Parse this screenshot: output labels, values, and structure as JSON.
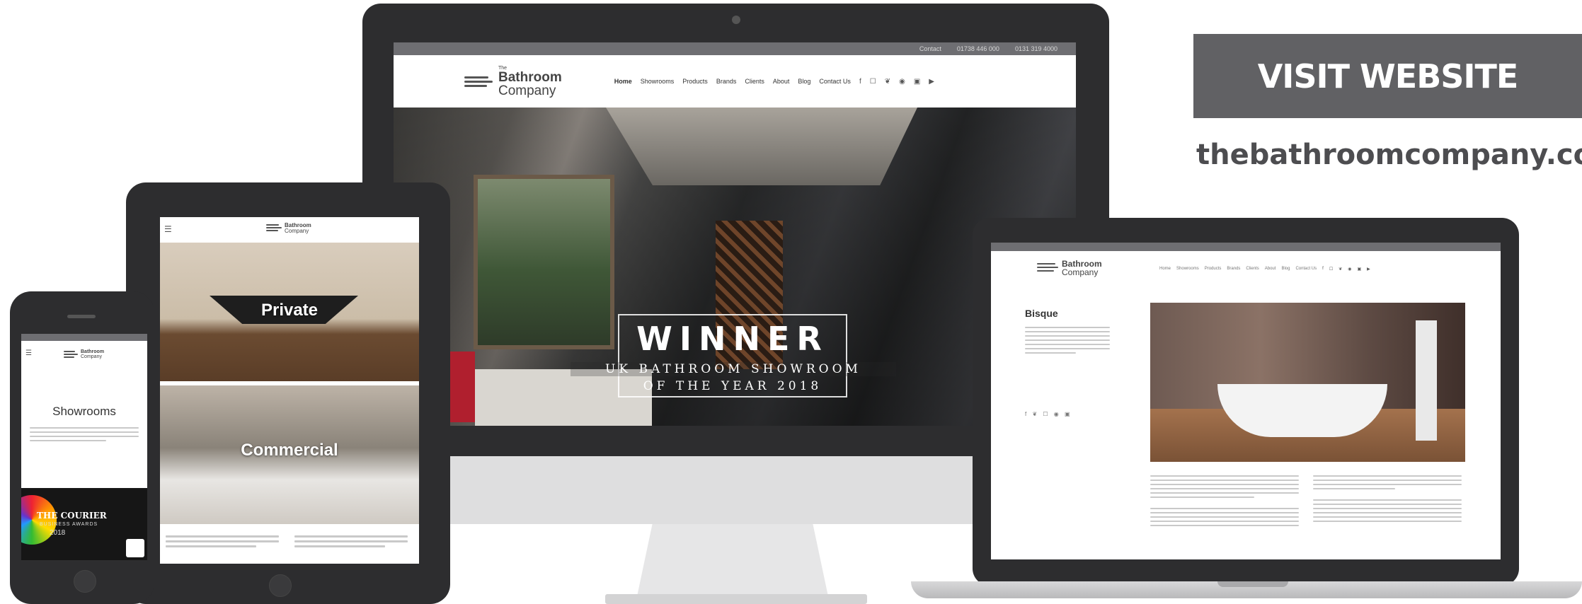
{
  "cta": {
    "button_label": "VISIT WEBSITE",
    "url_text": "thebathroomcompany.co"
  },
  "brand": {
    "logo_small": "The",
    "logo_line1": "Bathroom",
    "logo_line2": "Company"
  },
  "desktop": {
    "topbar": [
      "Contact",
      "01738 446 000",
      "0131 319 4000"
    ],
    "nav": [
      "Home",
      "Showrooms",
      "Products",
      "Brands",
      "Clients",
      "About",
      "Blog",
      "Contact Us"
    ],
    "social_icons": [
      "facebook-icon",
      "instagram-icon",
      "twitter-icon",
      "pinterest-icon",
      "linkedin-icon",
      "youtube-icon"
    ],
    "hero": {
      "title": "WINNER",
      "subtitle_line1": "UK BATHROOM SHOWROOM",
      "subtitle_line2": "OF THE YEAR 2018"
    }
  },
  "tablet": {
    "tiles": [
      {
        "label": "Private"
      },
      {
        "label": "Commercial"
      }
    ]
  },
  "phone": {
    "heading": "Showrooms",
    "award_line1": "THE COURIER",
    "award_line2": "BUSINESS AWARDS",
    "award_line3": "2018"
  },
  "laptop": {
    "nav": [
      "Home",
      "Showrooms",
      "Products",
      "Brands",
      "Clients",
      "About",
      "Blog",
      "Contact Us"
    ],
    "heading": "Bisque"
  },
  "colors": {
    "cta_background": "#616164",
    "cta_url_text": "#4d4d50",
    "device_bezel": "#2d2d2f",
    "topbar": "#6e6e72",
    "award_red": "#b01f2e"
  }
}
